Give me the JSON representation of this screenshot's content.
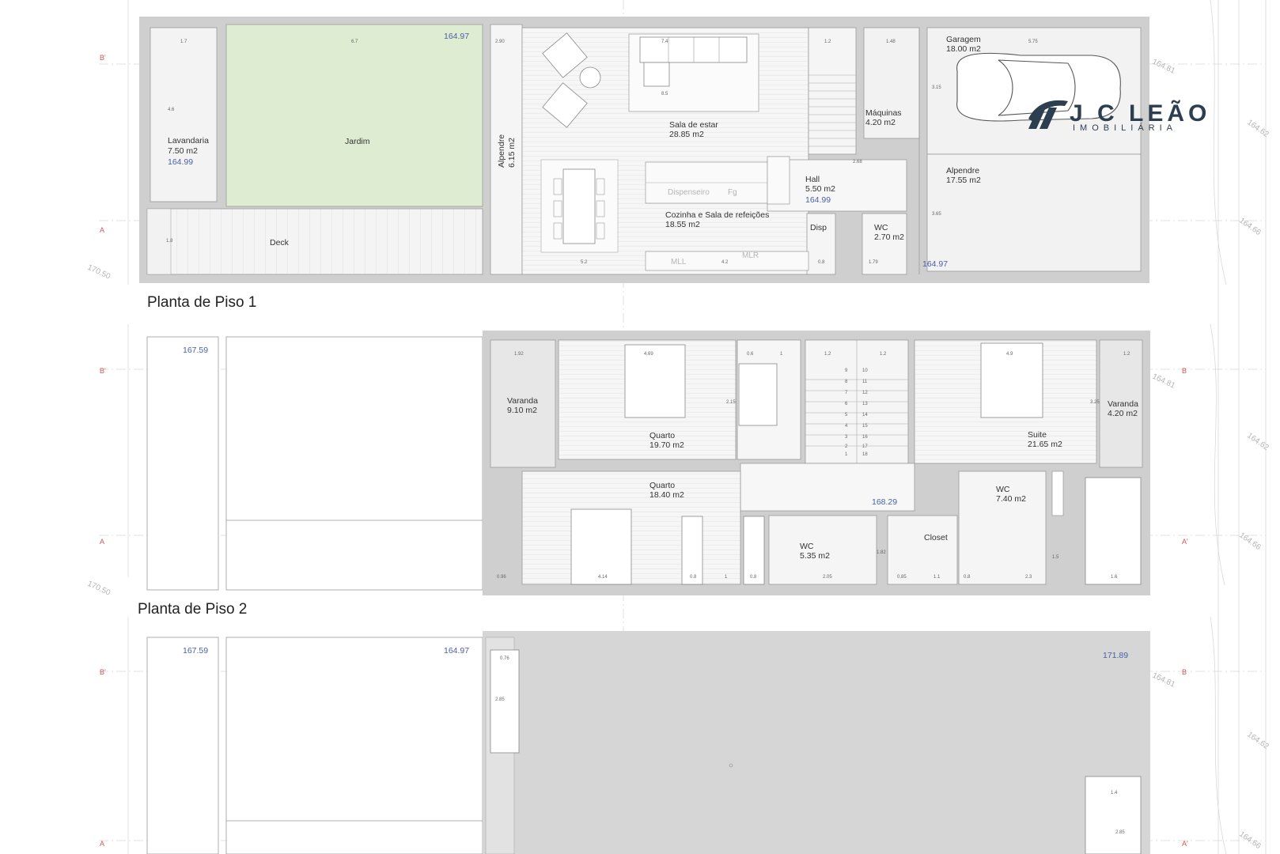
{
  "logo": {
    "name": "J C LEÃO",
    "sub": "IMOBILIÁRIA"
  },
  "floor1": {
    "title": "Planta de Piso 1",
    "rooms": {
      "lavandaria": {
        "name": "Lavandaria",
        "area": "7.50 m2",
        "elev": "164.99"
      },
      "jardim": {
        "name": "Jardim"
      },
      "deck": {
        "name": "Deck"
      },
      "alpendre": {
        "name": "Alpendre",
        "area": "6.15 m2"
      },
      "sala": {
        "name": "Sala de estar",
        "area": "28.85 m2"
      },
      "cozinha": {
        "name": "Cozinha e Sala de refeições",
        "area": "18.55 m2"
      },
      "despensa": {
        "name": "Dispenseiro",
        "tag": "Fg"
      },
      "hall": {
        "name": "Hall",
        "area": "5.50 m2",
        "elev": "164.99"
      },
      "disp": {
        "name": "Disp"
      },
      "wc": {
        "name": "WC",
        "area": "2.70 m2"
      },
      "maquinas": {
        "name": "Máquinas",
        "area": "4.20 m2"
      },
      "garagem": {
        "name": "Garagem",
        "area": "18.00 m2"
      },
      "alpendre2": {
        "name": "Alpendre",
        "area": "17.55 m2"
      }
    },
    "elevations": {
      "garden": "164.97",
      "garage": "164.97"
    },
    "appliances": [
      "MLL",
      "MLR"
    ]
  },
  "floor2": {
    "title": "Planta de Piso 2",
    "rooms": {
      "varanda1": {
        "name": "Varanda",
        "area": "9.10 m2"
      },
      "quarto1": {
        "name": "Quarto",
        "area": "19.70 m2"
      },
      "quarto2": {
        "name": "Quarto",
        "area": "18.40 m2"
      },
      "wc1": {
        "name": "WC",
        "area": "5.35 m2"
      },
      "closet": {
        "name": "Closet"
      },
      "suite": {
        "name": "Suite",
        "area": "21.65 m2"
      },
      "wc2": {
        "name": "WC",
        "area": "7.40 m2"
      },
      "varanda2": {
        "name": "Varanda",
        "area": "4.20 m2"
      }
    },
    "elevations": {
      "left": "167.59",
      "landing": "168.29"
    }
  },
  "floor3": {
    "elevations": {
      "left": "167.59",
      "mid": "164.97",
      "right": "171.89"
    }
  },
  "axis_labels": {
    "b_prime": "B'",
    "a": "A",
    "b": "B",
    "a_prime": "A'"
  },
  "side_levels": [
    "164.81",
    "164.62",
    "164.66"
  ],
  "left_level": "170.50",
  "dims": {
    "f1": [
      "1.7",
      "6.7",
      "2.90",
      "7.4",
      "1.2",
      "1.48",
      "5.75",
      "4.6",
      "8.5",
      "2.68",
      "5.2",
      "4.2",
      "0.8",
      "1.79",
      "3.15",
      "3.65",
      "1.8"
    ],
    "f2": [
      "1.92",
      "4.69",
      "0.6",
      "1",
      "1.2",
      "1.2",
      "4.9",
      "1.2",
      "2.15",
      "3.25",
      "0.96",
      "4.14",
      "0.8",
      "1",
      "0.8",
      "2.05",
      "0.85",
      "1.1",
      "0.8",
      "2.3",
      "1.6",
      "1.82",
      "1.5"
    ],
    "f3": [
      "0.76",
      "2.85",
      "1.4",
      "2.85"
    ]
  },
  "stairs": [
    "1",
    "2",
    "3",
    "4",
    "5",
    "6",
    "7",
    "8",
    "9",
    "10",
    "11",
    "12",
    "13",
    "14",
    "15",
    "16",
    "17",
    "18"
  ]
}
